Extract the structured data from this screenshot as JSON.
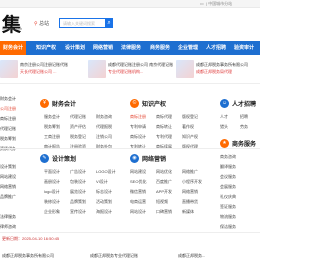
{
  "topbar": {
    "left": "",
    "right": "| 中国城市分站",
    "flag": "▭"
  },
  "logo": {
    "glyph": "集",
    "url": "xxcom.com"
  },
  "location": {
    "pin": "⚲",
    "city": "总站",
    "more": "[切换]"
  },
  "search": {
    "placeholder": "请输入关键词搜索",
    "button": "⌕"
  },
  "nav": [
    {
      "label": "财务会计"
    },
    {
      "label": "知识产权"
    },
    {
      "label": "设计策划"
    },
    {
      "label": "网络营销"
    },
    {
      "label": "法律服务"
    },
    {
      "label": "商务服务"
    },
    {
      "label": "企业管理"
    },
    {
      "label": "人才招聘"
    },
    {
      "label": "验资审计"
    }
  ],
  "ads": [
    {
      "line1": "南京注册公司注册记账代账",
      "line2": "天长代理记账公司 ...",
      "tag": ""
    },
    {
      "line1": "成都代理记账注册公司 南京代理记账",
      "line2": "专业代理记账机构...",
      "tag": "申请"
    },
    {
      "line1": "成都正邦税务事务所有限公司",
      "line2": "成都正邦税务局代理",
      "tag": "热线"
    }
  ],
  "sidebar_left": [
    "财务会计",
    "公司注册",
    "商标注册",
    "代理记账",
    "税务筹划",
    "资质代办",
    "",
    "设计策划",
    "网站建设",
    "网络营销",
    "品牌推广",
    "",
    "法律服务",
    "律师咨询"
  ],
  "panels": [
    {
      "title": "财务会计",
      "icon": "¥",
      "color": "#ff6a00",
      "cells": [
        "服务会计",
        "代理记账",
        "财务咨询",
        "税务筹划",
        "资产评估",
        "代理报税",
        "工商注册",
        "税务登记",
        "注销公司",
        "审计报告",
        "注册验资",
        "财务外包"
      ]
    },
    {
      "title": "知识产权",
      "icon": "©",
      "color": "#ff6a00",
      "cells": [
        "商标注册",
        "商标代理",
        "版权登记",
        "专利申请",
        "商标转让",
        "著作权",
        "商标设计",
        "专利代理",
        "知识产权",
        "专利转让",
        "商标续展",
        "版权代理"
      ]
    },
    {
      "title": "人才招聘",
      "icon": "☺",
      "color": "#1e6fd0",
      "cells": [
        "人才",
        "招聘",
        "猎头",
        "劳务"
      ]
    },
    {
      "title": "设计策划",
      "icon": "✎",
      "color": "#1e6fd0",
      "cells": [
        "平面设计",
        "广告设计",
        "LOGO设计",
        "画册设计",
        "包装设计",
        "VI设计",
        "logo设计",
        "展览设计",
        "标志设计",
        "装修设计",
        "品牌策划",
        "活动策划",
        "企业形象",
        "宣传设计",
        "海报设计"
      ]
    },
    {
      "title": "网络营销",
      "icon": "◉",
      "color": "#1e6fd0",
      "cells": [
        "网站建设",
        "网站优化",
        "网络推广",
        "SEO优化",
        "百度推广",
        "小程序开发",
        "微信营销",
        "APP开发",
        "网络营销",
        "电商运营",
        "短视频",
        "直播带货",
        "网站设计",
        "口碑营销",
        "新媒体"
      ]
    },
    {
      "title": "商务服务",
      "icon": "★",
      "color": "#ff6a00",
      "cells": [
        "商务咨询",
        "翻译服务",
        "会议服务",
        "会展服务",
        "礼仪庆典",
        "签证服务",
        "物流服务",
        "保洁服务",
        "办公服务",
        "企业服务"
      ]
    }
  ],
  "footer": {
    "date": "更新日期：2025-04-10 16:50:45",
    "items": [
      "成都正邦税务事务所有限公司",
      "成都正邦税务专业代理记账",
      "成都正邦税务..."
    ]
  }
}
